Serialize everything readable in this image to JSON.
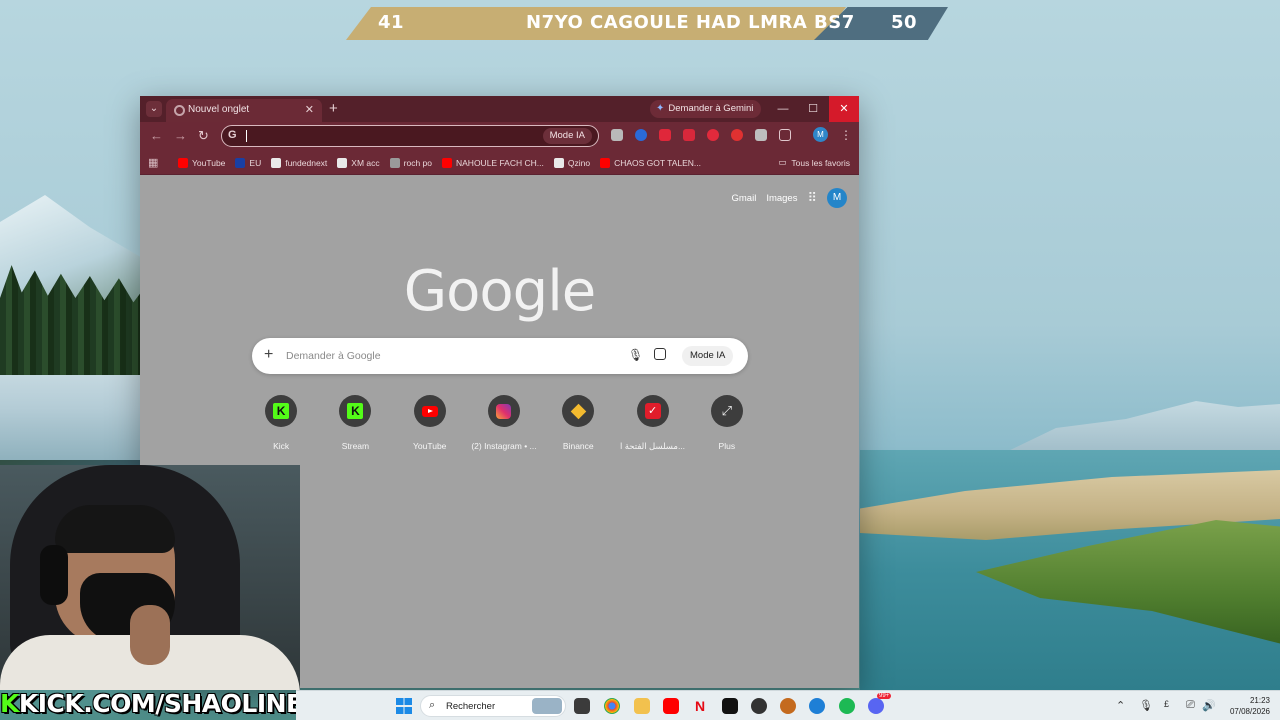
{
  "score": {
    "left": "41",
    "title": "N7YO CAGOULE HAD LMRA BS7",
    "right": "50"
  },
  "browser": {
    "tab_title": "Nouvel onglet",
    "gemini_label": "Demander à Gemini",
    "omnibox_mode": "Mode IA",
    "bookmarks": [
      {
        "label": "YouTube",
        "color": "#ff0000"
      },
      {
        "label": "EU",
        "color": "#1a3fa3"
      },
      {
        "label": "fundednext",
        "color": "#e9e9e9"
      },
      {
        "label": "XM acc",
        "color": "#e9e9e9"
      },
      {
        "label": "roch po",
        "color": "#9a9a9a"
      },
      {
        "label": "NAHOULE FACH CH...",
        "color": "#ff0000"
      },
      {
        "label": "Qzino",
        "color": "#e9e9e9"
      },
      {
        "label": "CHAOS GOT TALEN...",
        "color": "#ff0000"
      }
    ],
    "all_bookmarks": "Tous les favoris",
    "profile_initial": "M"
  },
  "ntp": {
    "gmail": "Gmail",
    "images": "Images",
    "avatar": "M",
    "logo": "Google",
    "search_placeholder": "Demander à Google",
    "mode_ia": "Mode IA",
    "shortcuts": [
      {
        "label": "Kick",
        "icon": "kick-icon"
      },
      {
        "label": "Stream",
        "icon": "kick-icon"
      },
      {
        "label": "YouTube",
        "icon": "youtube-icon"
      },
      {
        "label": "(2) Instagram • ...",
        "icon": "instagram-icon"
      },
      {
        "label": "Binance",
        "icon": "binance-icon"
      },
      {
        "label": "مسلسل الفتحة ا...",
        "icon": "tk-icon"
      },
      {
        "label": "Plus",
        "icon": "plus-icon"
      }
    ]
  },
  "stream": {
    "banner_k": "K",
    "banner_rest": "KICK.COM/SHAOLINE"
  },
  "taskbar": {
    "search_label": "Rechercher",
    "time": "21:23",
    "date": "07/08/2026",
    "notification_count": "99+"
  }
}
